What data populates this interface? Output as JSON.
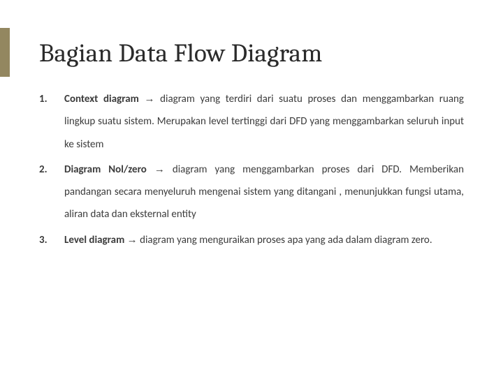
{
  "title": "Bagian Data Flow Diagram",
  "items": [
    {
      "num": "1.",
      "term": "Context diagram",
      "arrow": "→",
      "desc": "diagram yang terdiri dari suatu proses dan menggambarkan ruang lingkup suatu sistem. Merupakan level tertinggi dari DFD yang menggambarkan seluruh input ke sistem"
    },
    {
      "num": "2.",
      "term": "Diagram Nol/zero",
      "arrow": "→",
      "desc": "diagram yang menggambarkan proses dari DFD. Memberikan pandangan secara menyeluruh mengenai sistem yang ditangani , menunjukkan fungsi utama, aliran data dan eksternal entity"
    },
    {
      "num": "3.",
      "term": "Level diagram",
      "arrow": "→",
      "desc": "diagram yang menguraikan proses apa yang ada dalam diagram zero."
    }
  ]
}
